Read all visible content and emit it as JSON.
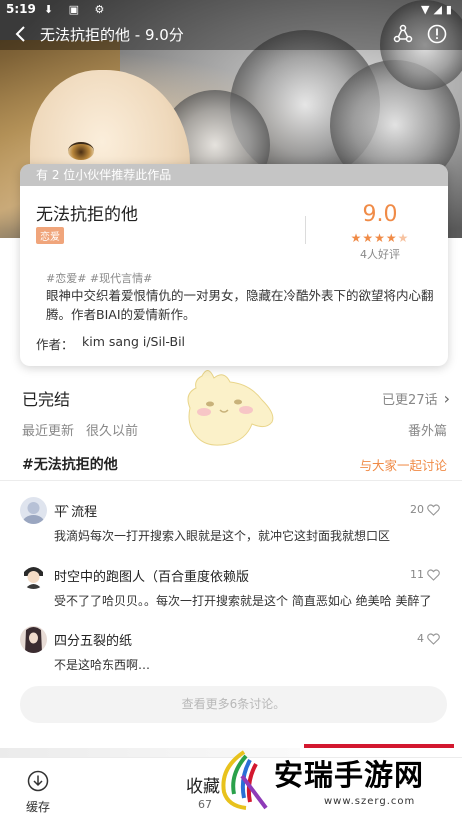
{
  "status_bar": {
    "time": "5:19",
    "left_icons": "⬇ ▣ ⚙",
    "right_icons": "▼◢▮"
  },
  "header": {
    "title": "无法抗拒的他 - 9.0分"
  },
  "card": {
    "recommend_text": "有 2 位小伙伴推荐此作品",
    "name": "无法抗拒的他",
    "genre": "恋爱",
    "score": "9.0",
    "stars_full": "★★★★",
    "stars_half": "★",
    "rating_fraction": 0.9,
    "reviews": "4人好评",
    "tags": "#恋爱# #现代言情#",
    "description": "眼神中交织着爱恨情仇的一对男女，隐藏在冷酷外表下的欲望将内心翻腾。作者BIAI的爱情新作。",
    "author_label": "作者：",
    "author": "kim sang i/Sil-Bil"
  },
  "status": {
    "state": "已完结",
    "updated": "已更27话",
    "recent_label": "最近更新",
    "recent_value": "很久以前",
    "extra": "番外篇"
  },
  "topic": {
    "title": "#无法抗拒的他",
    "discuss": "与大家一起讨论"
  },
  "comments": [
    {
      "user": "平 ̀流程",
      "likes": "20",
      "text": "我滴妈每次一打开搜索入眼就是这个，就冲它这封面我就想口区"
    },
    {
      "user": "时空中的跑图人（百合重度依赖版",
      "likes": "11",
      "text": "受不了了哈贝贝。。每次一打开搜索就是这个 简直恶如心 绝美哈 美醉了"
    },
    {
      "user": "四分五裂的纸",
      "likes": "4",
      "text": "不是这哈东西啊…"
    }
  ],
  "more_button": "查看更多6条讨论。",
  "bottom": {
    "download_label": "缓存",
    "favorite_label": "收藏",
    "favorite_count": "67"
  },
  "watermark": {
    "brand": "安瑞手游网",
    "url": "www.szerg.com"
  },
  "colors": {
    "accent": "#f08b47",
    "watermark_red": "#d3182f"
  }
}
